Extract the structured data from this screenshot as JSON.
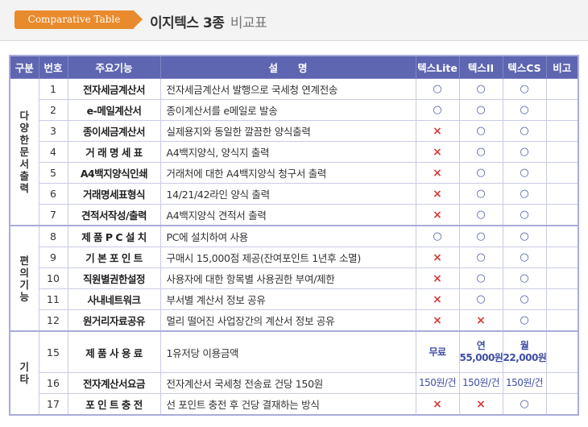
{
  "header": {
    "tag": "Comparative Table",
    "title": "이지텍스 3종",
    "title_suffix": "비교표",
    "accent_color": "#e98a2c"
  },
  "table": {
    "columns": [
      "구분",
      "번호",
      "주요기능",
      "설　　명",
      "텍스Lite",
      "텍스II",
      "텍스CS",
      "비고"
    ],
    "header_color": "#5e66b1",
    "groups": [
      {
        "category": [
          "다",
          "양",
          "한",
          "문",
          "서",
          "출",
          "력"
        ],
        "rows": [
          {
            "num": "1",
            "name": "전자세금계산서",
            "desc": "전자세금계산서 발행으로 국세청 연계전송",
            "lite": "○",
            "two": "○",
            "cs": "○"
          },
          {
            "num": "2",
            "name": "e-메일계산서",
            "desc": "종이계산서를 e메일로 발송",
            "lite": "○",
            "two": "○",
            "cs": "○"
          },
          {
            "num": "3",
            "name": "종이세금계산서",
            "desc": "실제용지와 동일한 깔끔한 양식출력",
            "lite": "×",
            "two": "○",
            "cs": "○"
          },
          {
            "num": "4",
            "name": "거 래 명 세 표",
            "desc": "A4백지양식, 양식지 출력",
            "lite": "×",
            "two": "○",
            "cs": "○"
          },
          {
            "num": "5",
            "name": "A4백지양식인쇄",
            "desc": "거래처에 대한 A4백지양식 청구서 출력",
            "lite": "×",
            "two": "○",
            "cs": "○"
          },
          {
            "num": "6",
            "name": "거래명세표형식",
            "desc": "14/21/42라인 양식 출력",
            "lite": "×",
            "two": "○",
            "cs": "○"
          },
          {
            "num": "7",
            "name": "견적서작성/출력",
            "desc": "A4백지양식 견적서 출력",
            "lite": "×",
            "two": "○",
            "cs": "○"
          }
        ]
      },
      {
        "category": [
          "편",
          "의",
          "기",
          "능"
        ],
        "rows": [
          {
            "num": "8",
            "name": "제 품 P C 설 치",
            "desc": "PC에 설치하여 사용",
            "lite": "○",
            "two": "○",
            "cs": "○"
          },
          {
            "num": "9",
            "name": "기 본 포 인 트",
            "desc": "구매시 15,000점 제공(잔여포인트 1년후 소멸)",
            "lite": "×",
            "two": "○",
            "cs": "○"
          },
          {
            "num": "10",
            "name": "직원별권한설정",
            "desc": "사용자에 대한 항목별 사용권한 부여/제한",
            "lite": "×",
            "two": "○",
            "cs": "○"
          },
          {
            "num": "11",
            "name": "사내네트워크",
            "desc": "부서별 계산서 정보 공유",
            "lite": "×",
            "two": "○",
            "cs": "○"
          },
          {
            "num": "12",
            "name": "원거리자료공유",
            "desc": "멀리 떨어진 사업장간의 계산서 정보 공유",
            "lite": "×",
            "two": "×",
            "cs": "○"
          }
        ]
      },
      {
        "category": [
          "기",
          "타"
        ],
        "rows": [
          {
            "num": "15",
            "name": "제 품 사 용 료",
            "desc": "1유저당 이용금액",
            "lite": "무료",
            "two_line1": "연",
            "two_line2": "55,000원",
            "cs_line1": "월",
            "cs_line2": "22,000원"
          },
          {
            "num": "16",
            "name": "전자계산서요금",
            "desc": "전자계산서 국세청 전송료 건당 150원",
            "lite": "150원/건",
            "two": "150원/건",
            "cs": "150원/건"
          },
          {
            "num": "17",
            "name": "포 인 트 충 전",
            "desc": "선 포인트 충전 후 건당 결재하는 방식",
            "lite": "×",
            "two": "×",
            "cs": "○"
          }
        ]
      }
    ]
  }
}
